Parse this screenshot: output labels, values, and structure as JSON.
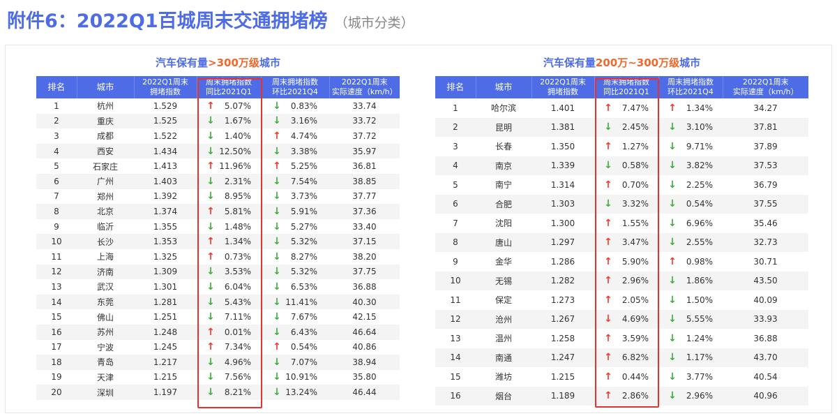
{
  "header": {
    "title": "附件6：2022Q1百城周末交通拥堵榜",
    "subtitle": "（城市分类）"
  },
  "columns": [
    "排名",
    "城市",
    "2022Q1周末\n拥堵指数",
    "周末拥堵指数\n同比2021Q1",
    "周末拥堵指数\n环比2021Q4",
    "2022Q1周末\n实际速度（km/h）"
  ],
  "columns_split": [
    {
      "l1": "排名",
      "l2": ""
    },
    {
      "l1": "城市",
      "l2": ""
    },
    {
      "l1": "2022Q1周末",
      "l2": "拥堵指数"
    },
    {
      "l1": "周末拥堵指数",
      "l2": "同比2021Q1"
    },
    {
      "l1": "周末拥堵指数",
      "l2": "环比2021Q4"
    },
    {
      "l1": "2022Q1周末",
      "l2": "实际速度（km/h）"
    }
  ],
  "colors": {
    "brand_blue": "#4e6ce6",
    "highlight_orange": "#f0682a",
    "up_red": "#f03a2a",
    "down_green": "#3fae3a",
    "box_red": "#e8312a"
  },
  "tables": [
    {
      "title_prefix": "汽车保有量",
      "title_highlight": ">300万级",
      "title_suffix": "城市",
      "rows": [
        {
          "rank": "1",
          "city": "杭州",
          "index": "1.529",
          "yoy_dir": "up",
          "yoy": "5.07%",
          "qoq_dir": "down",
          "qoq": "0.83%",
          "speed": "33.74"
        },
        {
          "rank": "2",
          "city": "重庆",
          "index": "1.525",
          "yoy_dir": "down",
          "yoy": "1.67%",
          "qoq_dir": "down",
          "qoq": "3.16%",
          "speed": "33.72"
        },
        {
          "rank": "3",
          "city": "成都",
          "index": "1.522",
          "yoy_dir": "down",
          "yoy": "1.40%",
          "qoq_dir": "up",
          "qoq": "4.74%",
          "speed": "37.72"
        },
        {
          "rank": "4",
          "city": "西安",
          "index": "1.434",
          "yoy_dir": "down",
          "yoy": "12.50%",
          "qoq_dir": "down",
          "qoq": "3.38%",
          "speed": "35.97"
        },
        {
          "rank": "5",
          "city": "石家庄",
          "index": "1.413",
          "yoy_dir": "up",
          "yoy": "11.96%",
          "qoq_dir": "up",
          "qoq": "5.25%",
          "speed": "36.81"
        },
        {
          "rank": "6",
          "city": "广州",
          "index": "1.403",
          "yoy_dir": "down",
          "yoy": "2.31%",
          "qoq_dir": "down",
          "qoq": "7.54%",
          "speed": "38.85"
        },
        {
          "rank": "7",
          "city": "郑州",
          "index": "1.392",
          "yoy_dir": "down",
          "yoy": "8.95%",
          "qoq_dir": "down",
          "qoq": "3.73%",
          "speed": "37.77"
        },
        {
          "rank": "8",
          "city": "北京",
          "index": "1.374",
          "yoy_dir": "up",
          "yoy": "5.81%",
          "qoq_dir": "down",
          "qoq": "5.91%",
          "speed": "37.36"
        },
        {
          "rank": "9",
          "city": "临沂",
          "index": "1.355",
          "yoy_dir": "down",
          "yoy": "1.48%",
          "qoq_dir": "down",
          "qoq": "5.27%",
          "speed": "33.40"
        },
        {
          "rank": "10",
          "city": "长沙",
          "index": "1.353",
          "yoy_dir": "up",
          "yoy": "1.34%",
          "qoq_dir": "down",
          "qoq": "5.32%",
          "speed": "37.15"
        },
        {
          "rank": "11",
          "city": "上海",
          "index": "1.325",
          "yoy_dir": "up",
          "yoy": "0.73%",
          "qoq_dir": "down",
          "qoq": "8.27%",
          "speed": "38.20"
        },
        {
          "rank": "12",
          "city": "济南",
          "index": "1.309",
          "yoy_dir": "down",
          "yoy": "3.53%",
          "qoq_dir": "down",
          "qoq": "5.32%",
          "speed": "37.75"
        },
        {
          "rank": "13",
          "city": "武汉",
          "index": "1.301",
          "yoy_dir": "down",
          "yoy": "6.04%",
          "qoq_dir": "down",
          "qoq": "6.53%",
          "speed": "36.88"
        },
        {
          "rank": "14",
          "city": "东莞",
          "index": "1.281",
          "yoy_dir": "down",
          "yoy": "5.43%",
          "qoq_dir": "down",
          "qoq": "11.41%",
          "speed": "40.30"
        },
        {
          "rank": "15",
          "city": "佛山",
          "index": "1.251",
          "yoy_dir": "down",
          "yoy": "7.11%",
          "qoq_dir": "down",
          "qoq": "7.67%",
          "speed": "42.15"
        },
        {
          "rank": "16",
          "city": "苏州",
          "index": "1.248",
          "yoy_dir": "up",
          "yoy": "0.01%",
          "qoq_dir": "down",
          "qoq": "6.43%",
          "speed": "46.64"
        },
        {
          "rank": "17",
          "city": "宁波",
          "index": "1.245",
          "yoy_dir": "up",
          "yoy": "7.34%",
          "qoq_dir": "up",
          "qoq": "0.54%",
          "speed": "40.86"
        },
        {
          "rank": "18",
          "city": "青岛",
          "index": "1.217",
          "yoy_dir": "down",
          "yoy": "4.96%",
          "qoq_dir": "down",
          "qoq": "7.07%",
          "speed": "38.94"
        },
        {
          "rank": "19",
          "city": "天津",
          "index": "1.215",
          "yoy_dir": "down",
          "yoy": "7.56%",
          "qoq_dir": "down",
          "qoq": "10.91%",
          "speed": "35.80"
        },
        {
          "rank": "20",
          "city": "深圳",
          "index": "1.197",
          "yoy_dir": "down",
          "yoy": "8.21%",
          "qoq_dir": "down",
          "qoq": "13.24%",
          "speed": "46.44"
        }
      ]
    },
    {
      "title_prefix": "汽车保有量",
      "title_highlight": "200万~300万级",
      "title_suffix": "城市",
      "rows": [
        {
          "rank": "1",
          "city": "哈尔滨",
          "index": "1.401",
          "yoy_dir": "up",
          "yoy": "7.47%",
          "qoq_dir": "up",
          "qoq": "1.34%",
          "speed": "34.27"
        },
        {
          "rank": "2",
          "city": "昆明",
          "index": "1.381",
          "yoy_dir": "down",
          "yoy": "2.45%",
          "qoq_dir": "down",
          "qoq": "3.10%",
          "speed": "37.81"
        },
        {
          "rank": "3",
          "city": "长春",
          "index": "1.350",
          "yoy_dir": "up",
          "yoy": "1.27%",
          "qoq_dir": "down",
          "qoq": "9.71%",
          "speed": "37.89"
        },
        {
          "rank": "4",
          "city": "南京",
          "index": "1.339",
          "yoy_dir": "down",
          "yoy": "0.58%",
          "qoq_dir": "down",
          "qoq": "3.82%",
          "speed": "37.53"
        },
        {
          "rank": "5",
          "city": "南宁",
          "index": "1.314",
          "yoy_dir": "up",
          "yoy": "0.70%",
          "qoq_dir": "down",
          "qoq": "2.25%",
          "speed": "36.79"
        },
        {
          "rank": "6",
          "city": "合肥",
          "index": "1.303",
          "yoy_dir": "down",
          "yoy": "3.32%",
          "qoq_dir": "down",
          "qoq": "0.54%",
          "speed": "37.55"
        },
        {
          "rank": "7",
          "city": "沈阳",
          "index": "1.300",
          "yoy_dir": "up",
          "yoy": "1.55%",
          "qoq_dir": "down",
          "qoq": "6.96%",
          "speed": "35.46"
        },
        {
          "rank": "8",
          "city": "唐山",
          "index": "1.297",
          "yoy_dir": "up",
          "yoy": "3.47%",
          "qoq_dir": "down",
          "qoq": "2.55%",
          "speed": "32.73"
        },
        {
          "rank": "9",
          "city": "金华",
          "index": "1.286",
          "yoy_dir": "up",
          "yoy": "5.90%",
          "qoq_dir": "up",
          "qoq": "0.98%",
          "speed": "30.71"
        },
        {
          "rank": "10",
          "city": "无锡",
          "index": "1.282",
          "yoy_dir": "up",
          "yoy": "2.96%",
          "qoq_dir": "down",
          "qoq": "1.86%",
          "speed": "43.50"
        },
        {
          "rank": "11",
          "city": "保定",
          "index": "1.273",
          "yoy_dir": "up",
          "yoy": "2.05%",
          "qoq_dir": "down",
          "qoq": "1.50%",
          "speed": "40.09"
        },
        {
          "rank": "12",
          "city": "沧州",
          "index": "1.267",
          "yoy_dir": "down-red",
          "yoy": "4.69%",
          "qoq_dir": "down",
          "qoq": "5.55%",
          "speed": "33.93"
        },
        {
          "rank": "13",
          "city": "温州",
          "index": "1.258",
          "yoy_dir": "up",
          "yoy": "3.59%",
          "qoq_dir": "down",
          "qoq": "1.24%",
          "speed": "36.88"
        },
        {
          "rank": "14",
          "city": "南通",
          "index": "1.247",
          "yoy_dir": "up",
          "yoy": "6.82%",
          "qoq_dir": "down",
          "qoq": "1.17%",
          "speed": "43.70"
        },
        {
          "rank": "15",
          "city": "潍坊",
          "index": "1.215",
          "yoy_dir": "up",
          "yoy": "0.44%",
          "qoq_dir": "down",
          "qoq": "3.77%",
          "speed": "40.54"
        },
        {
          "rank": "16",
          "city": "烟台",
          "index": "1.189",
          "yoy_dir": "up",
          "yoy": "2.86%",
          "qoq_dir": "down",
          "qoq": "2.96%",
          "speed": "40.96"
        }
      ]
    }
  ],
  "icons": {
    "up": "↑",
    "down": "↓",
    "up_name": "arrow-up-icon",
    "down_name": "arrow-down-icon"
  }
}
